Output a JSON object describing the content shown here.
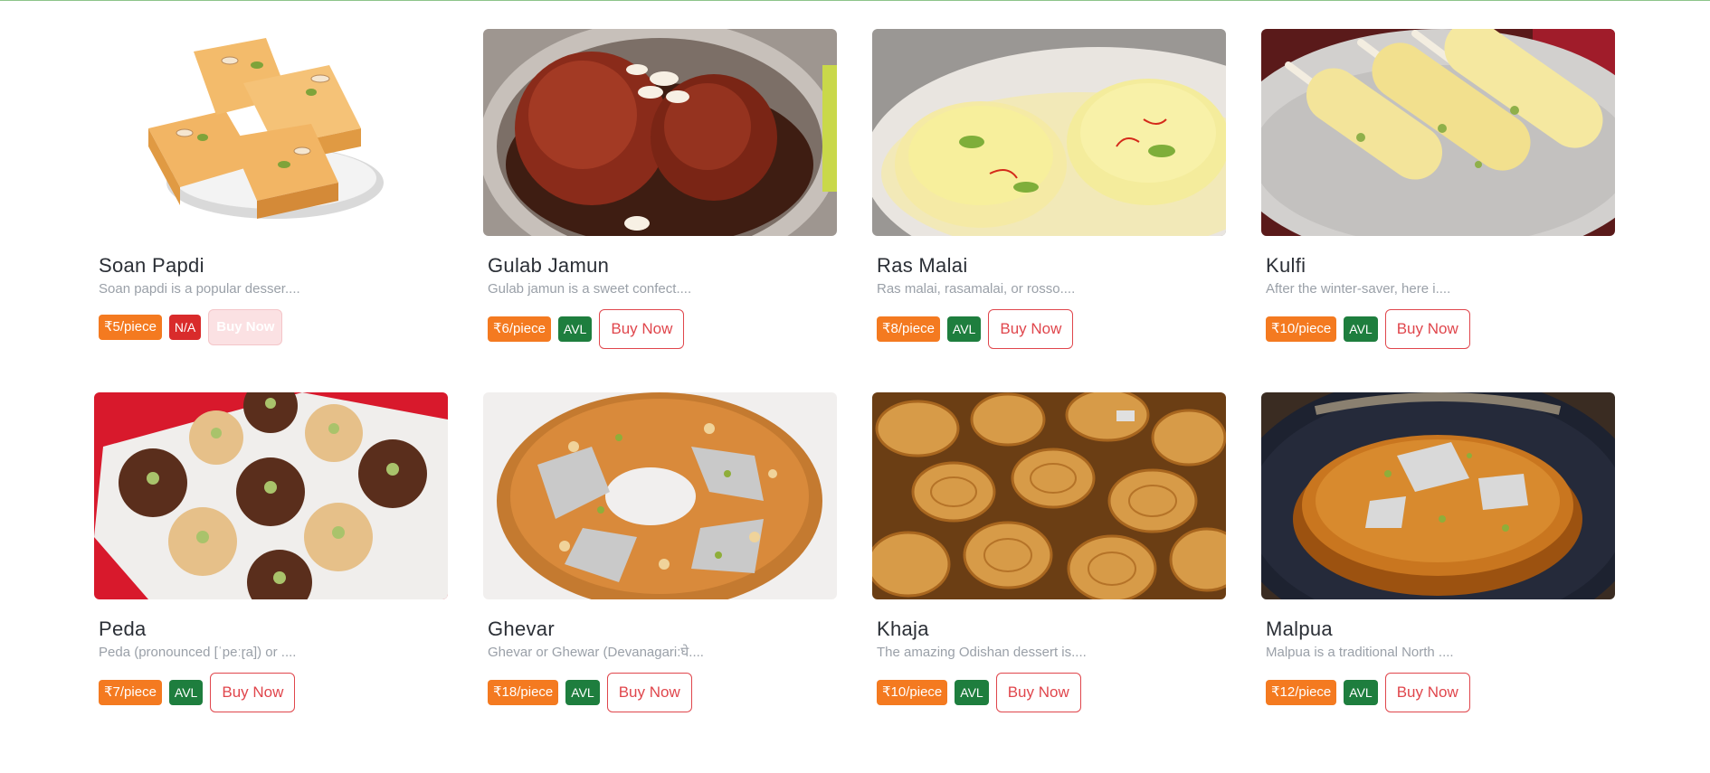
{
  "products": [
    {
      "name": "Soan Papdi",
      "desc": "Soan papdi is a popular desser....",
      "price": "₹5/piece",
      "availability": "N/A",
      "available": false,
      "buy_label": "Buy Now",
      "image_colors": [
        "#ffffff",
        "#f2b564",
        "#e09a43"
      ]
    },
    {
      "name": "Gulab Jamun",
      "desc": "Gulab jamun is a sweet confect....",
      "price": "₹6/piece",
      "availability": "AVL",
      "available": true,
      "buy_label": "Buy Now",
      "image_colors": [
        "#b9b3ad",
        "#8a2b1a",
        "#5c1a10"
      ]
    },
    {
      "name": "Ras Malai",
      "desc": "Ras malai, rasamalai, or rosso....",
      "price": "₹8/piece",
      "availability": "AVL",
      "available": true,
      "buy_label": "Buy Now",
      "image_colors": [
        "#e9e5e0",
        "#f5eaa5",
        "#e8d671"
      ]
    },
    {
      "name": "Kulfi",
      "desc": "After the winter-saver, here i....",
      "price": "₹10/piece",
      "availability": "AVL",
      "available": true,
      "buy_label": "Buy Now",
      "image_colors": [
        "#c9c7c5",
        "#f3e49a",
        "#e9d27a"
      ]
    },
    {
      "name": "Peda",
      "desc": "Peda (pronounced [ˈpeːɽa]) or ....",
      "price": "₹7/piece",
      "availability": "AVL",
      "available": true,
      "buy_label": "Buy Now",
      "image_colors": [
        "#d8192c",
        "#f0eeec",
        "#5a2e1c"
      ]
    },
    {
      "name": "Ghevar",
      "desc": "Ghevar or Ghewar (Devanagari:घे....",
      "price": "₹18/piece",
      "availability": "AVL",
      "available": true,
      "buy_label": "Buy Now",
      "image_colors": [
        "#f1efee",
        "#d98a3b",
        "#c9c9c9"
      ]
    },
    {
      "name": "Khaja",
      "desc": "The amazing Odishan dessert is....",
      "price": "₹10/piece",
      "availability": "AVL",
      "available": true,
      "buy_label": "Buy Now",
      "image_colors": [
        "#6b3e14",
        "#d79b48",
        "#a8661f"
      ]
    },
    {
      "name": "Malpua",
      "desc": "Malpua is a traditional North ....",
      "price": "₹12/piece",
      "availability": "AVL",
      "available": true,
      "buy_label": "Buy Now",
      "image_colors": [
        "#1d2230",
        "#c9761f",
        "#9c5210"
      ]
    }
  ],
  "colors": {
    "price_badge": "#f47a20",
    "avl_badge": "#1e7e3e",
    "na_badge": "#d92b2b",
    "buy_border": "#e0464c",
    "top_line": "#8dc48a"
  }
}
